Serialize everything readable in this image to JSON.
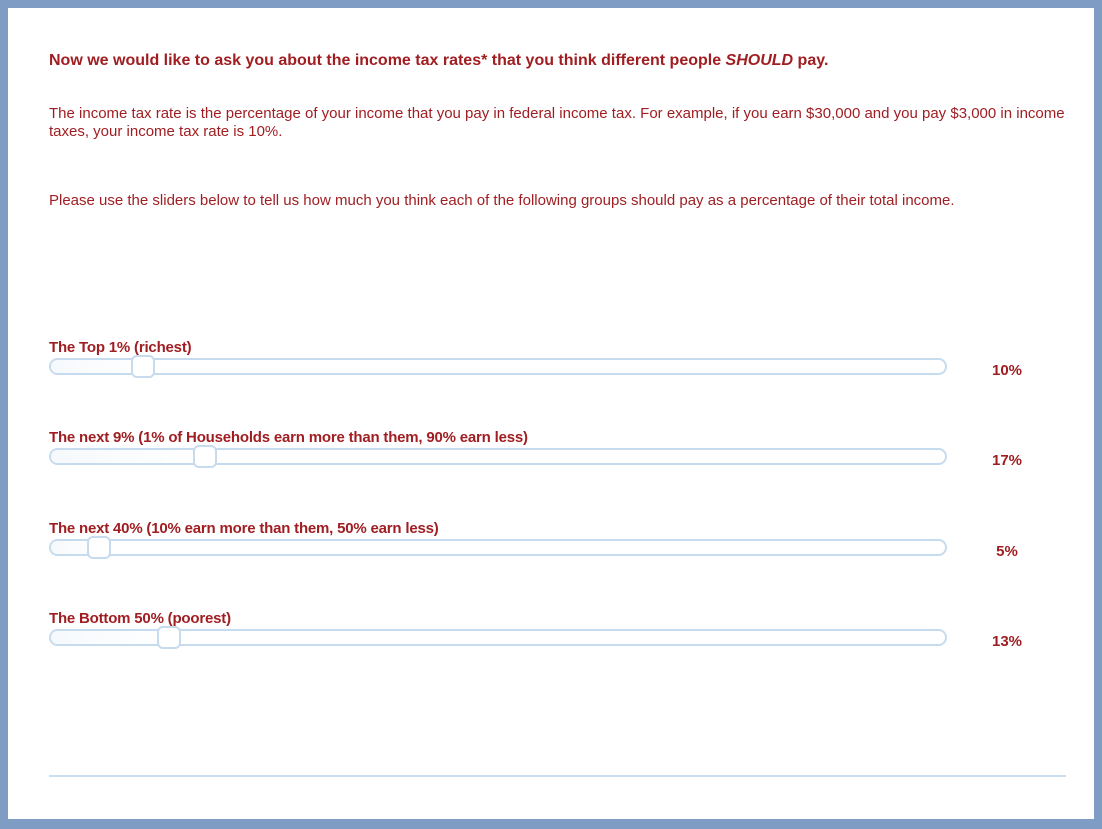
{
  "survey": {
    "heading_prefix": "Now we would like to ask you about the income tax rates* that you think different people ",
    "heading_emphasis": "SHOULD",
    "heading_suffix": " pay.",
    "definition": "The income tax rate is the percentage of your income that you pay in federal income tax. For example, if you earn $30,000 and you pay $3,000 in income taxes, your income tax rate is 10%.",
    "instructions": "Please use the sliders below to tell us how much you think each of the following groups should pay as a percentage of their total income."
  },
  "sliders": [
    {
      "label": "The Top 1% (richest)",
      "value_text": "10%",
      "position_fraction": 0.103
    },
    {
      "label": "The next 9% (1% of Households earn more than them, 90% earn less)",
      "value_text": "17%",
      "position_fraction": 0.172
    },
    {
      "label": "The next 40% (10% earn more than them, 50% earn less)",
      "value_text": "5%",
      "position_fraction": 0.054
    },
    {
      "label": "The Bottom 50% (poorest)",
      "value_text": "13%",
      "position_fraction": 0.132
    }
  ],
  "colors": {
    "frame": "#7f9cc4",
    "text": "#a01e22",
    "slider_border": "#c7dbef"
  }
}
